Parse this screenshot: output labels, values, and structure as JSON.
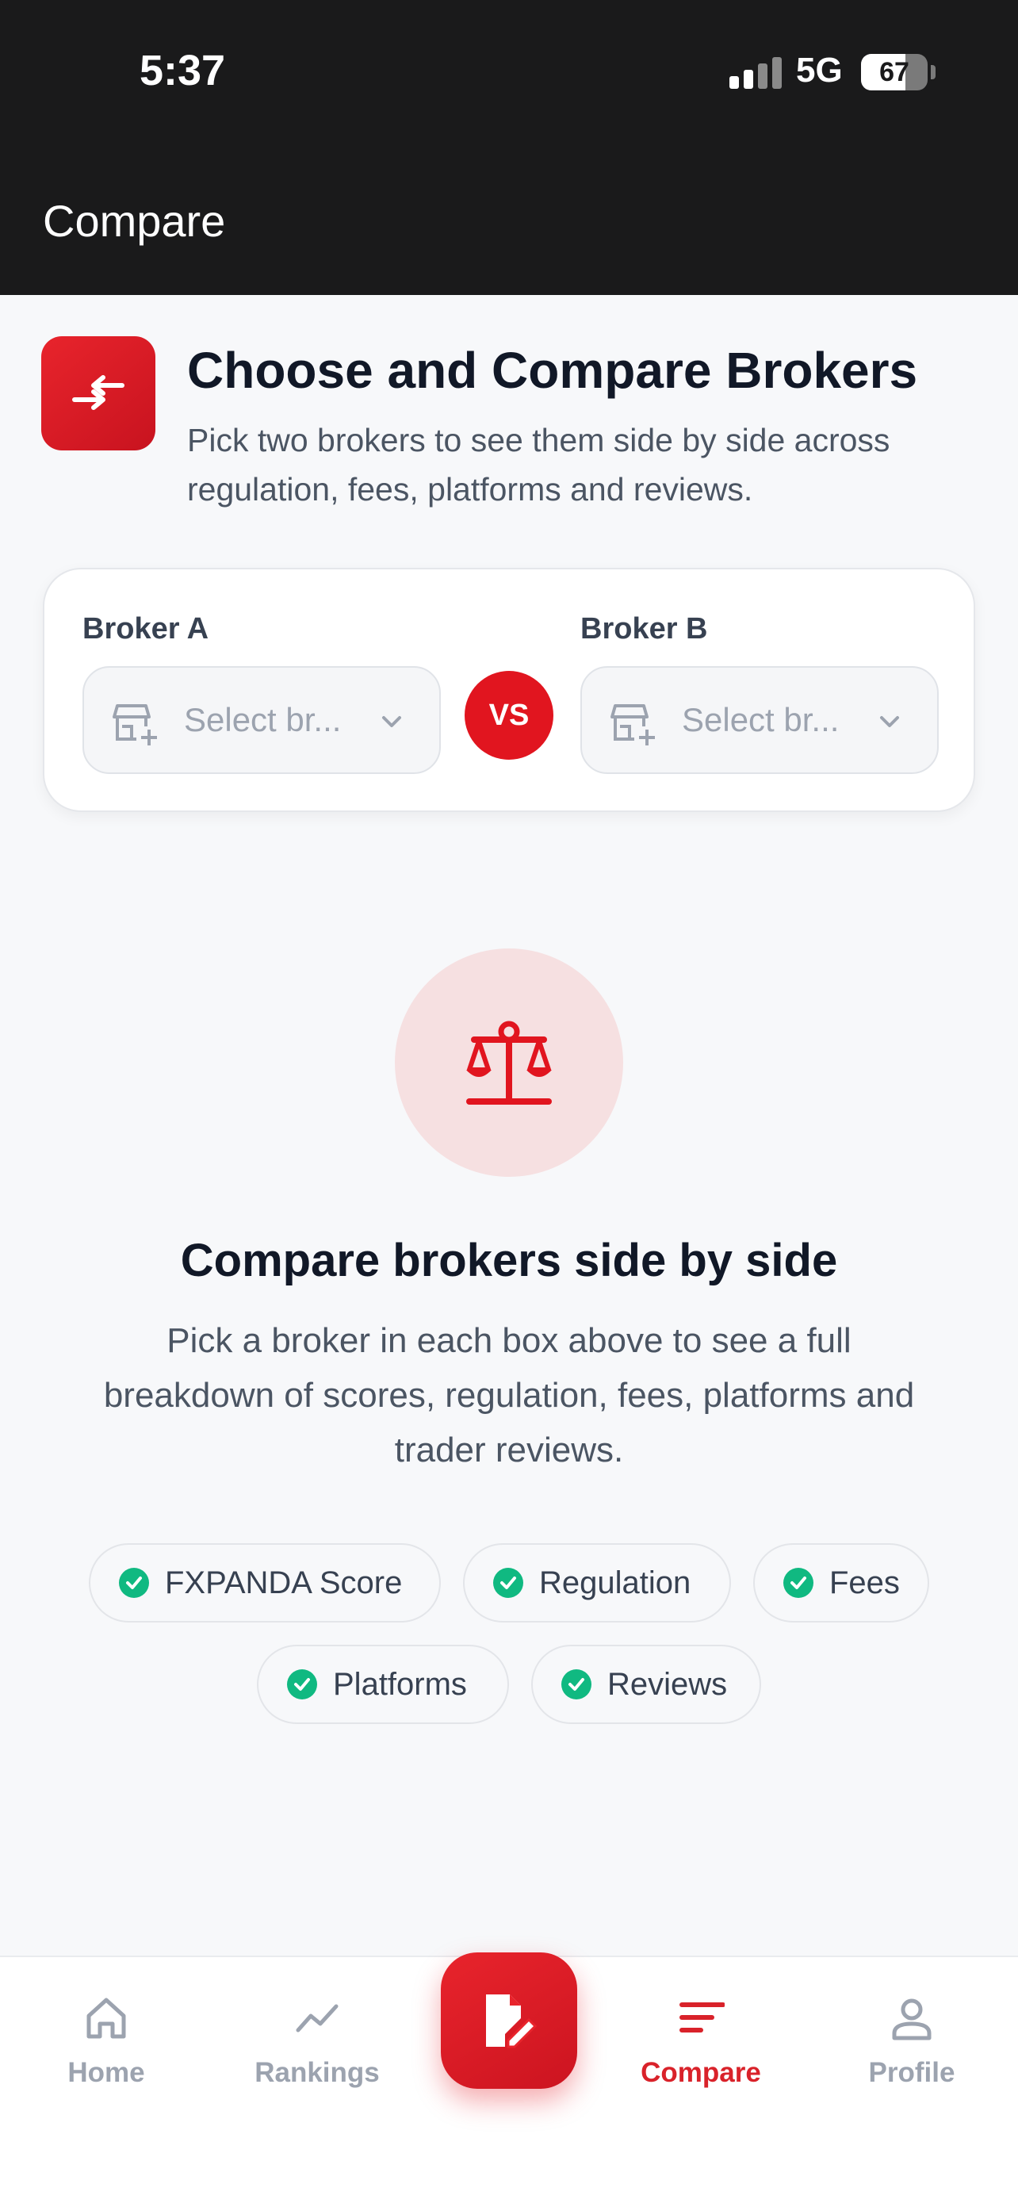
{
  "status_bar": {
    "time": "5:37",
    "network": "5G",
    "battery": "67",
    "battery_level": 0.67
  },
  "header": {
    "title": "Compare"
  },
  "intro": {
    "icon": "compare-arrows-icon",
    "title": "Choose and Compare Brokers",
    "subtitle": "Pick two brokers to see them side by side across regulation, fees, platforms and reviews."
  },
  "selector": {
    "broker_a": {
      "label": "Broker A",
      "placeholder": "Select br..."
    },
    "broker_b": {
      "label": "Broker B",
      "placeholder": "Select br..."
    },
    "vs": "VS"
  },
  "empty_state": {
    "icon": "scale-icon",
    "title": "Compare brokers side by side",
    "description": "Pick a broker in each box above to see a full breakdown of scores, regulation, fees, platforms and trader reviews."
  },
  "chips": [
    "FXPANDA Score",
    "Regulation",
    "Fees",
    "Platforms",
    "Reviews"
  ],
  "nav": {
    "items": [
      {
        "label": "Home",
        "icon": "home-icon"
      },
      {
        "label": "Rankings",
        "icon": "trend-icon"
      },
      {
        "label": "Compare",
        "icon": "sort-lines-icon",
        "active": true
      },
      {
        "label": "Profile",
        "icon": "user-icon"
      }
    ],
    "fab_icon": "edit-document-icon"
  },
  "colors": {
    "accent": "#e1151f",
    "check": "#10b981",
    "header_bg": "#1a1a1b"
  }
}
